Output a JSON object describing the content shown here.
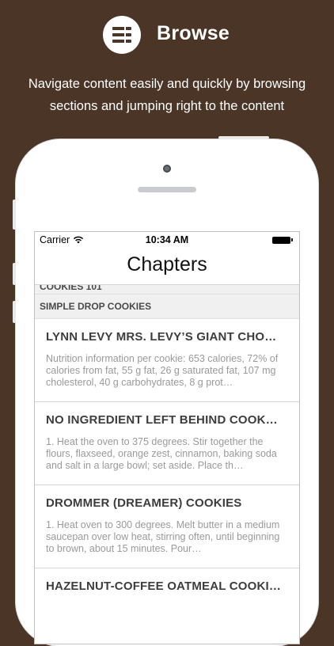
{
  "header": {
    "icon": "list-icon",
    "title": "Browse",
    "subtitle": "Navigate content easily and quickly by browsing sections and jumping right to the content"
  },
  "status_bar": {
    "carrier": "Carrier",
    "time": "10:34 AM"
  },
  "nav": {
    "title": "Chapters"
  },
  "sections": [
    {
      "label": "COOKIES 101"
    },
    {
      "label": "SIMPLE DROP COOKIES"
    }
  ],
  "recipes": [
    {
      "title": "LYNN LEVY MRS. LEVY’S GIANT CHO…",
      "description": "Nutrition information per cookie: 653 calories, 72% of calories from fat, 55 g fat, 26 g saturated fat, 107 mg cholesterol, 40 g carbohydrates, 8 g prot…"
    },
    {
      "title": "NO INGREDIENT LEFT BEHIND COOK…",
      "description": "1. Heat the oven to 375 degrees. Stir together the flours, flaxseed, orange zest, cinnamon, baking soda and salt in a large bowl; set aside. Place th…"
    },
    {
      "title": "DROMMER (DREAMER) COOKIES",
      "description": "1. Heat oven to 300 degrees. Melt butter in a medium saucepan over low heat, stirring often, until beginning to brown, about 15 minutes. Pour…"
    },
    {
      "title": "HAZELNUT-COFFEE OATMEAL COOKI…",
      "description": ""
    }
  ],
  "colors": {
    "background": "#4a3526",
    "text_title": "#3d3d3d",
    "text_secondary": "#9a9a9a"
  }
}
